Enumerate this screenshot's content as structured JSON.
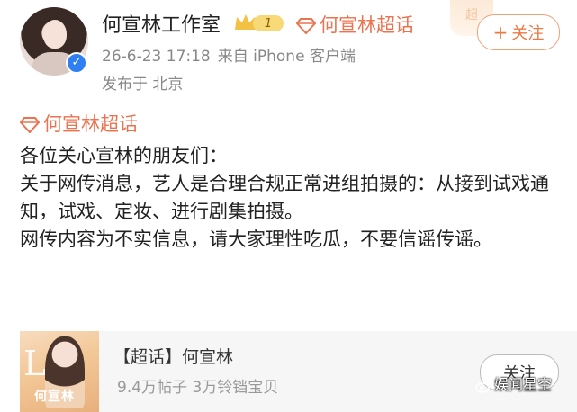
{
  "post": {
    "author": "何宣林工作室",
    "badge_level": "1",
    "super_tag": "何宣林超话",
    "timestamp": "26-6-23 17:18",
    "source": "来自 iPhone 客户端",
    "location": "发布于 北京",
    "follow_label": "关注"
  },
  "deco": {
    "label": "超"
  },
  "content": {
    "topic": "何宣林超话",
    "lines": [
      "各位关心宣林的朋友们：",
      "关于网传消息，艺人是合理合规正常进组拍摄的：从接到试戏通知，试戏、定妆、进行剧集拍摄。",
      "网传内容为不实信息，请大家理性吃瓜，不要信谣传谣。"
    ]
  },
  "card": {
    "title": "【超话】何宣林",
    "stats": "9.4万帖子 3万铃铛宝贝",
    "follow_label": "关注",
    "thumb_letters": "LE",
    "thumb_name": "何宣林"
  },
  "watermark": "娱闻星空",
  "colors": {
    "accent": "#eb7350",
    "verify_blue": "#2f7ff3",
    "card_bg": "#f6f6f6"
  }
}
